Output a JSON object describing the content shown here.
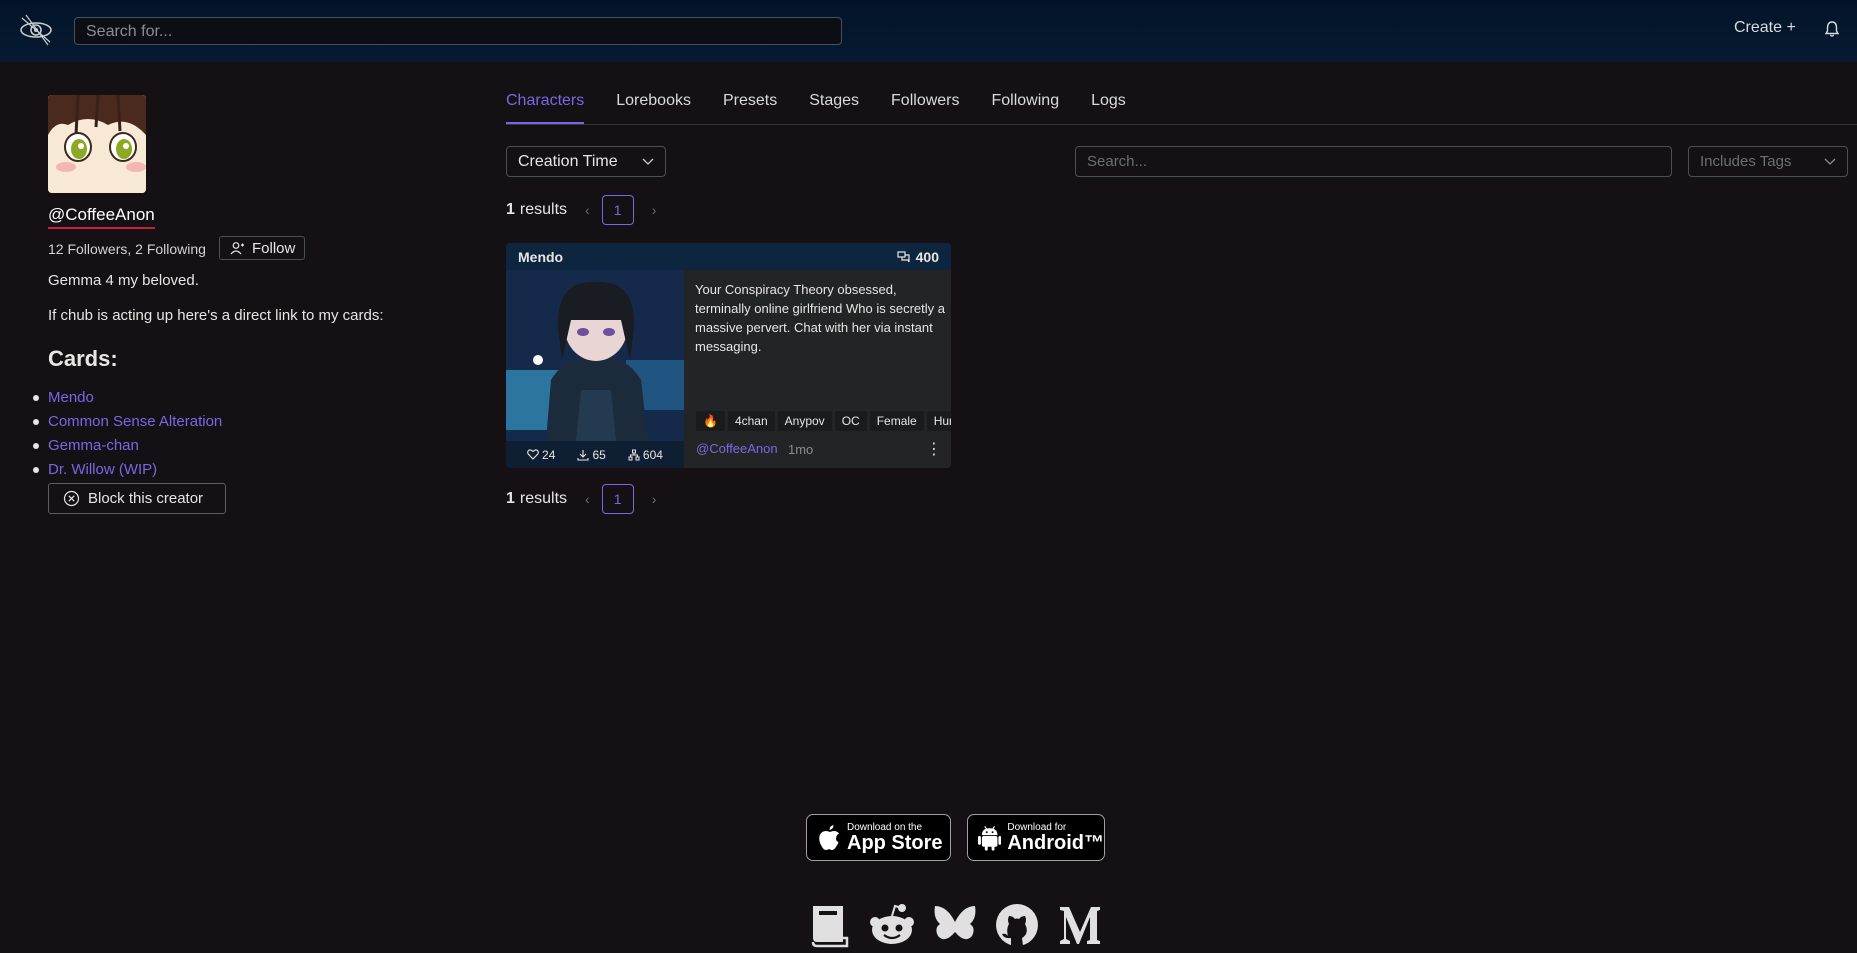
{
  "topbar": {
    "search_placeholder": "Search for...",
    "create_label": "Create +"
  },
  "profile": {
    "username": "@CoffeeAnon",
    "follow_stats": "12 Followers, 2 Following",
    "follow_label": "Follow",
    "bio_line1": "Gemma 4 my beloved.",
    "bio_line2": "If chub is acting up here's a direct link to my cards:",
    "cards_heading": "Cards:",
    "cards": [
      "Mendo",
      "Common Sense Alteration",
      "Gemma-chan",
      "Dr. Willow (WIP)"
    ],
    "block_label": "Block this creator"
  },
  "tabs": [
    "Characters",
    "Lorebooks",
    "Presets",
    "Stages",
    "Followers",
    "Following",
    "Logs"
  ],
  "active_tab": "Characters",
  "filters": {
    "sort_value": "Creation Time",
    "search_placeholder": "Search...",
    "tags_placeholder": "Includes Tags"
  },
  "pagination": {
    "count": "1",
    "label": "results",
    "page": "1"
  },
  "card": {
    "name": "Mendo",
    "chat_count": "400",
    "description": "Your Conspiracy Theory obsessed, terminally online girlfriend Who is secretly a massive pervert. Chat with her via instant messaging.",
    "tags": [
      "🔥",
      "4chan",
      "Anypov",
      "OC",
      "Female",
      "Human"
    ],
    "likes": "24",
    "downloads": "65",
    "forks": "604",
    "author": "@CoffeeAnon",
    "age": "1mo"
  },
  "footer": {
    "appstore_small": "Download on the",
    "appstore_big": "App Store",
    "android_small": "Download for",
    "android_big": "Android™"
  },
  "colors": {
    "accent": "#7b67e6",
    "background": "#141013",
    "topbar": "#03142a"
  }
}
